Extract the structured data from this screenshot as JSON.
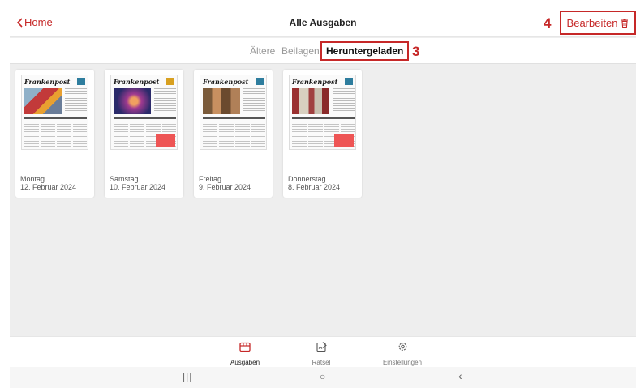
{
  "header": {
    "back_label": "Home",
    "title": "Alle Ausgaben",
    "edit_label": "Bearbeiten",
    "callout": "4"
  },
  "tabs": {
    "items": [
      {
        "label": "Ältere"
      },
      {
        "label": "Beilagen"
      },
      {
        "label": "Heruntergeladen",
        "selected": true
      }
    ],
    "callout": "3"
  },
  "issues": [
    {
      "masthead": "Frankenpost",
      "day": "Montag",
      "date": "12. Februar 2024"
    },
    {
      "masthead": "Frankenpost",
      "day": "Samstag",
      "date": "10. Februar 2024"
    },
    {
      "masthead": "Frankenpost",
      "day": "Freitag",
      "date": "9. Februar 2024"
    },
    {
      "masthead": "Frankenpost",
      "day": "Donnerstag",
      "date": "8. Februar 2024"
    }
  ],
  "bottom_nav": [
    {
      "label": "Ausgaben",
      "icon": "newspaper-icon",
      "active": true
    },
    {
      "label": "Rätsel",
      "icon": "puzzle-icon"
    },
    {
      "label": "Einstellungen",
      "icon": "settings-icon"
    }
  ],
  "system_nav": {
    "recents": "|||",
    "home": "○",
    "back": "‹"
  },
  "colors": {
    "accent": "#c62828",
    "background": "#eeeeee",
    "masthead_badge": "#2e7d9e"
  }
}
